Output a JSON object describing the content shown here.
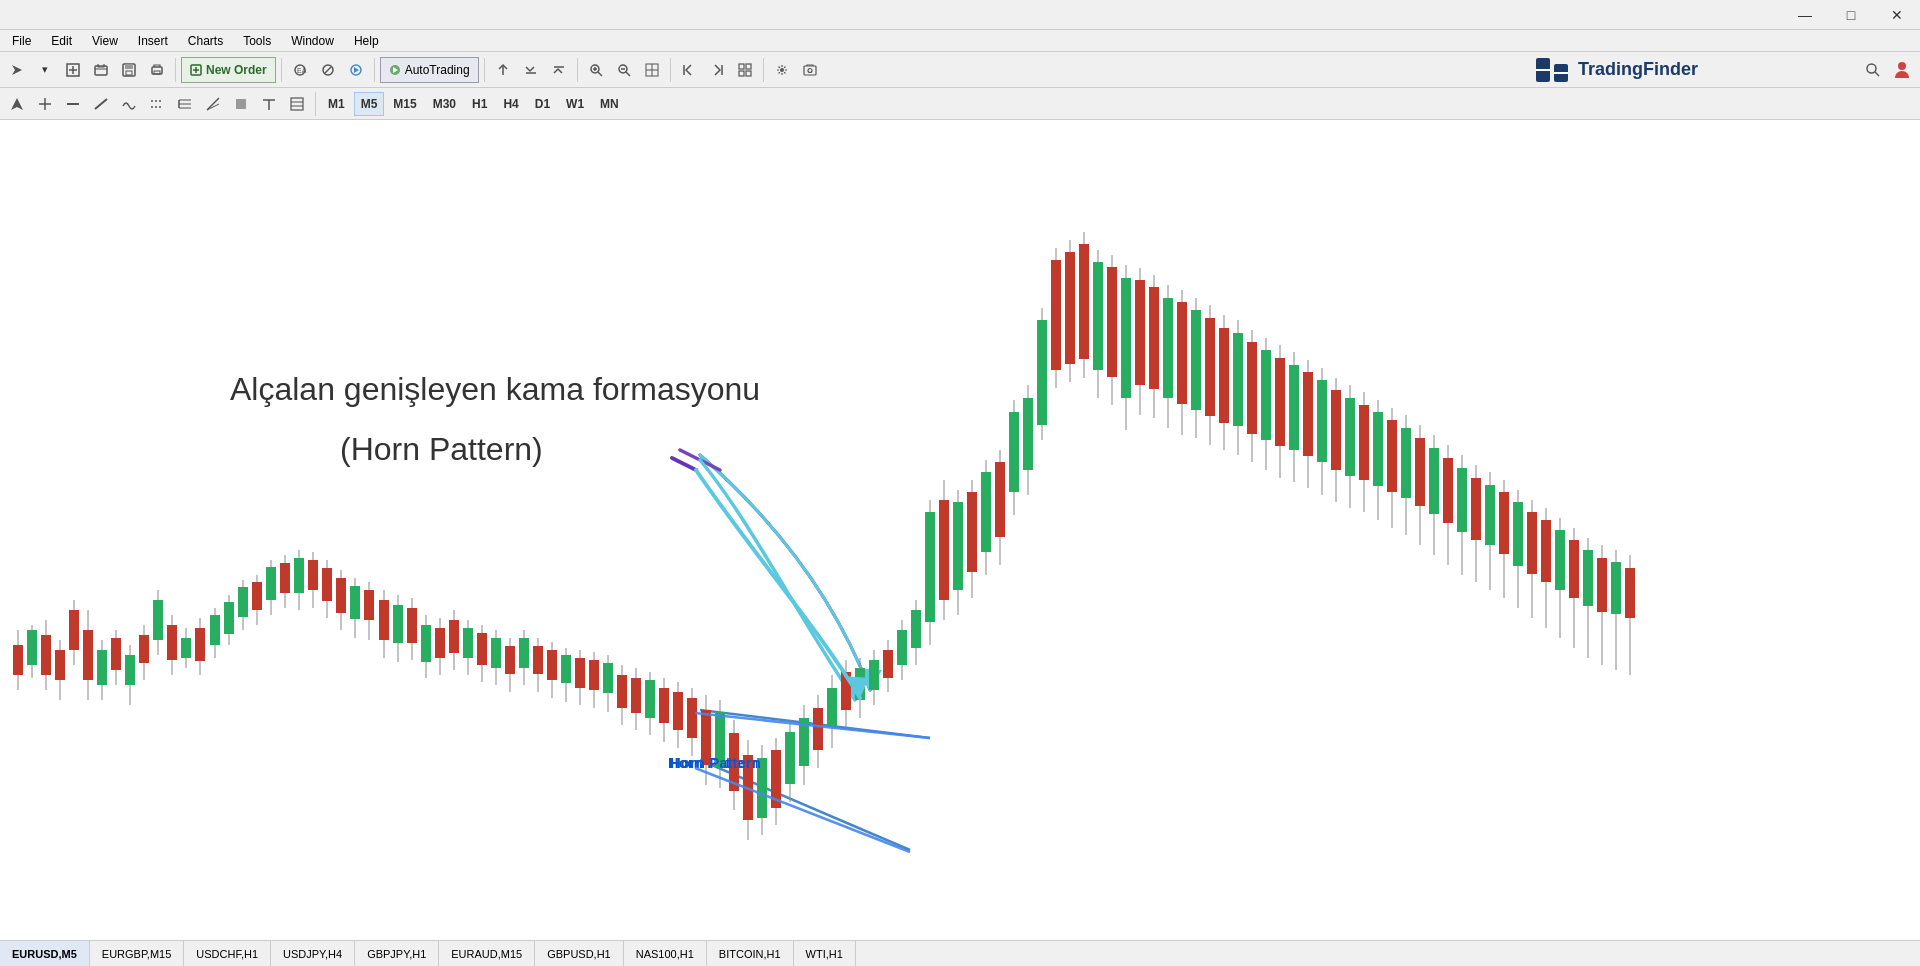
{
  "titlebar": {
    "logo_text": "TradingFinder",
    "min_label": "—",
    "max_label": "□",
    "close_label": "✕"
  },
  "menubar": {
    "items": [
      "File",
      "Edit",
      "View",
      "Insert",
      "Charts",
      "Tools",
      "Window",
      "Help"
    ]
  },
  "toolbar1": {
    "new_order_label": "New Order",
    "autotrading_label": "AutoTrading",
    "buttons": [
      {
        "icon": "↰",
        "tooltip": "arrow"
      },
      {
        "icon": "⊕",
        "tooltip": "cross"
      },
      {
        "icon": "✎",
        "tooltip": "pen"
      },
      {
        "icon": "∷",
        "tooltip": "dots"
      },
      {
        "icon": "◷",
        "tooltip": "history"
      },
      {
        "icon": "⬛",
        "tooltip": "chart"
      },
      {
        "icon": "🔍",
        "tooltip": "zoom-in"
      },
      {
        "icon": "🔍",
        "tooltip": "zoom-out"
      },
      {
        "icon": "⊞",
        "tooltip": "grid"
      },
      {
        "icon": "⊳",
        "tooltip": "next"
      },
      {
        "icon": "↑",
        "tooltip": "up"
      },
      {
        "icon": "⊡",
        "tooltip": "window"
      },
      {
        "icon": "⚙",
        "tooltip": "settings"
      },
      {
        "icon": "🖼",
        "tooltip": "screenshot"
      }
    ]
  },
  "toolbar2": {
    "draw_buttons": [
      "↖",
      "✛",
      "—",
      "↗",
      "〰",
      "⋯",
      "≈",
      "⊹",
      "▪",
      "≡",
      "◼"
    ],
    "timeframes": [
      "M1",
      "M5",
      "M15",
      "M30",
      "H1",
      "H4",
      "D1",
      "W1",
      "MN"
    ],
    "active_tf": "M5"
  },
  "chart": {
    "annotation_title_line1": "Alçalan genişleyen kama formasyonu",
    "annotation_title_line2": "(Horn Pattern)",
    "pattern_label": "Horn Pattern",
    "arrow_color": "#5bc8e0",
    "arrow_start_color": "#6633cc"
  },
  "statusbar": {
    "tabs": [
      "EURUSD,M5",
      "EURGBP,M15",
      "USDCHF,H1",
      "USDJPY,H4",
      "GBPJPY,H1",
      "EURAUD,M15",
      "GBPUSD,H1",
      "NAS100,H1",
      "BITCOIN,H1",
      "WTI,H1"
    ]
  },
  "scroll_indicator": "▼"
}
